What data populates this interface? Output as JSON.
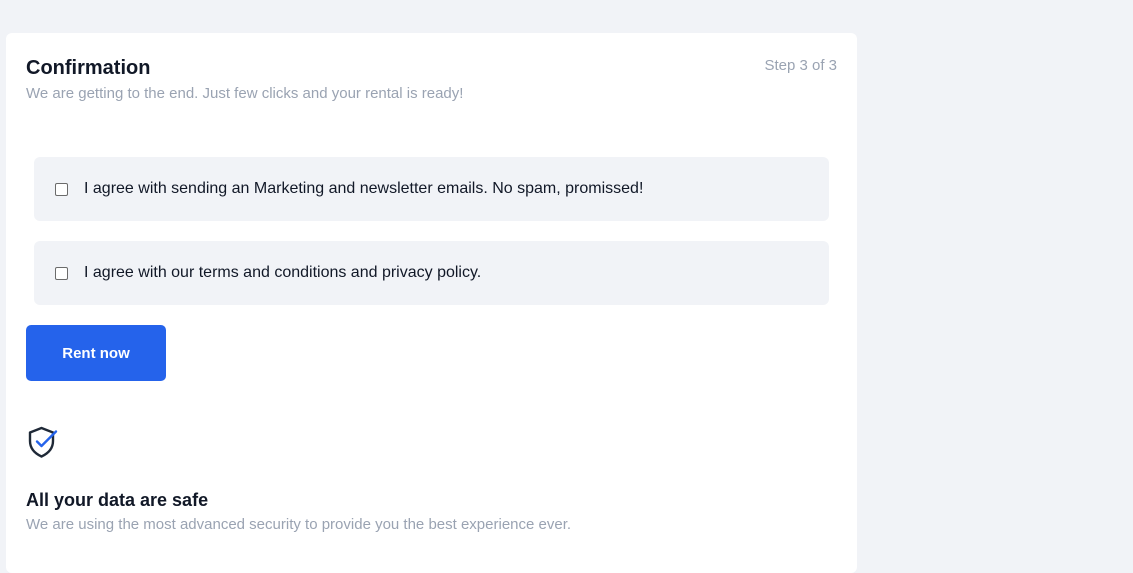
{
  "header": {
    "title": "Confirmation",
    "subtitle": "We are getting to the end. Just few clicks and your rental is ready!",
    "step": "Step 3 of 3"
  },
  "options": [
    {
      "label": "I agree with sending an Marketing and newsletter emails. No spam, promissed!",
      "checked": false
    },
    {
      "label": "I agree with our terms and conditions and privacy policy.",
      "checked": false
    }
  ],
  "actions": {
    "rent_label": "Rent now"
  },
  "security": {
    "icon": "shield-check-icon",
    "title": "All your data are safe",
    "text": "We are using the most advanced security to provide you the best experience ever."
  },
  "colors": {
    "accent": "#2563eb",
    "background": "#f1f3f7",
    "muted_text": "#9aa3b2",
    "primary_text": "#111827"
  }
}
